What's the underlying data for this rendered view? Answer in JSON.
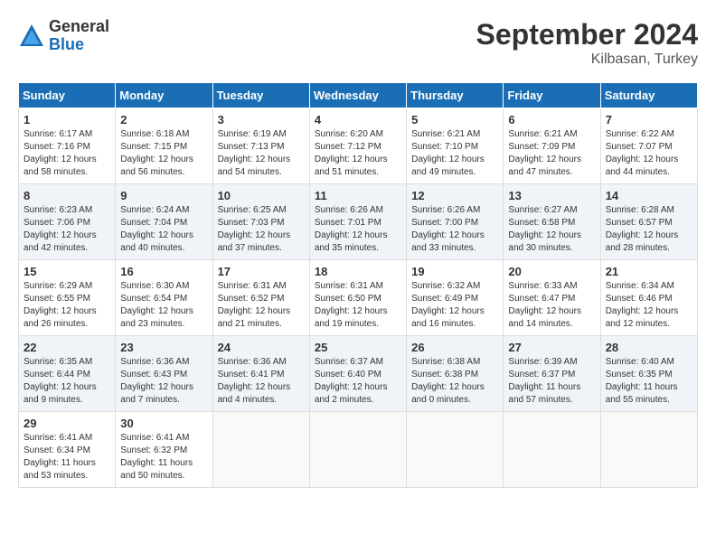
{
  "header": {
    "logo_general": "General",
    "logo_blue": "Blue",
    "title": "September 2024",
    "location": "Kilbasan, Turkey"
  },
  "calendar": {
    "days_of_week": [
      "Sunday",
      "Monday",
      "Tuesday",
      "Wednesday",
      "Thursday",
      "Friday",
      "Saturday"
    ],
    "weeks": [
      [
        {
          "day": "1",
          "info": "Sunrise: 6:17 AM\nSunset: 7:16 PM\nDaylight: 12 hours\nand 58 minutes."
        },
        {
          "day": "2",
          "info": "Sunrise: 6:18 AM\nSunset: 7:15 PM\nDaylight: 12 hours\nand 56 minutes."
        },
        {
          "day": "3",
          "info": "Sunrise: 6:19 AM\nSunset: 7:13 PM\nDaylight: 12 hours\nand 54 minutes."
        },
        {
          "day": "4",
          "info": "Sunrise: 6:20 AM\nSunset: 7:12 PM\nDaylight: 12 hours\nand 51 minutes."
        },
        {
          "day": "5",
          "info": "Sunrise: 6:21 AM\nSunset: 7:10 PM\nDaylight: 12 hours\nand 49 minutes."
        },
        {
          "day": "6",
          "info": "Sunrise: 6:21 AM\nSunset: 7:09 PM\nDaylight: 12 hours\nand 47 minutes."
        },
        {
          "day": "7",
          "info": "Sunrise: 6:22 AM\nSunset: 7:07 PM\nDaylight: 12 hours\nand 44 minutes."
        }
      ],
      [
        {
          "day": "8",
          "info": "Sunrise: 6:23 AM\nSunset: 7:06 PM\nDaylight: 12 hours\nand 42 minutes."
        },
        {
          "day": "9",
          "info": "Sunrise: 6:24 AM\nSunset: 7:04 PM\nDaylight: 12 hours\nand 40 minutes."
        },
        {
          "day": "10",
          "info": "Sunrise: 6:25 AM\nSunset: 7:03 PM\nDaylight: 12 hours\nand 37 minutes."
        },
        {
          "day": "11",
          "info": "Sunrise: 6:26 AM\nSunset: 7:01 PM\nDaylight: 12 hours\nand 35 minutes."
        },
        {
          "day": "12",
          "info": "Sunrise: 6:26 AM\nSunset: 7:00 PM\nDaylight: 12 hours\nand 33 minutes."
        },
        {
          "day": "13",
          "info": "Sunrise: 6:27 AM\nSunset: 6:58 PM\nDaylight: 12 hours\nand 30 minutes."
        },
        {
          "day": "14",
          "info": "Sunrise: 6:28 AM\nSunset: 6:57 PM\nDaylight: 12 hours\nand 28 minutes."
        }
      ],
      [
        {
          "day": "15",
          "info": "Sunrise: 6:29 AM\nSunset: 6:55 PM\nDaylight: 12 hours\nand 26 minutes."
        },
        {
          "day": "16",
          "info": "Sunrise: 6:30 AM\nSunset: 6:54 PM\nDaylight: 12 hours\nand 23 minutes."
        },
        {
          "day": "17",
          "info": "Sunrise: 6:31 AM\nSunset: 6:52 PM\nDaylight: 12 hours\nand 21 minutes."
        },
        {
          "day": "18",
          "info": "Sunrise: 6:31 AM\nSunset: 6:50 PM\nDaylight: 12 hours\nand 19 minutes."
        },
        {
          "day": "19",
          "info": "Sunrise: 6:32 AM\nSunset: 6:49 PM\nDaylight: 12 hours\nand 16 minutes."
        },
        {
          "day": "20",
          "info": "Sunrise: 6:33 AM\nSunset: 6:47 PM\nDaylight: 12 hours\nand 14 minutes."
        },
        {
          "day": "21",
          "info": "Sunrise: 6:34 AM\nSunset: 6:46 PM\nDaylight: 12 hours\nand 12 minutes."
        }
      ],
      [
        {
          "day": "22",
          "info": "Sunrise: 6:35 AM\nSunset: 6:44 PM\nDaylight: 12 hours\nand 9 minutes."
        },
        {
          "day": "23",
          "info": "Sunrise: 6:36 AM\nSunset: 6:43 PM\nDaylight: 12 hours\nand 7 minutes."
        },
        {
          "day": "24",
          "info": "Sunrise: 6:36 AM\nSunset: 6:41 PM\nDaylight: 12 hours\nand 4 minutes."
        },
        {
          "day": "25",
          "info": "Sunrise: 6:37 AM\nSunset: 6:40 PM\nDaylight: 12 hours\nand 2 minutes."
        },
        {
          "day": "26",
          "info": "Sunrise: 6:38 AM\nSunset: 6:38 PM\nDaylight: 12 hours\nand 0 minutes."
        },
        {
          "day": "27",
          "info": "Sunrise: 6:39 AM\nSunset: 6:37 PM\nDaylight: 11 hours\nand 57 minutes."
        },
        {
          "day": "28",
          "info": "Sunrise: 6:40 AM\nSunset: 6:35 PM\nDaylight: 11 hours\nand 55 minutes."
        }
      ],
      [
        {
          "day": "29",
          "info": "Sunrise: 6:41 AM\nSunset: 6:34 PM\nDaylight: 11 hours\nand 53 minutes."
        },
        {
          "day": "30",
          "info": "Sunrise: 6:41 AM\nSunset: 6:32 PM\nDaylight: 11 hours\nand 50 minutes."
        },
        {
          "day": "",
          "info": ""
        },
        {
          "day": "",
          "info": ""
        },
        {
          "day": "",
          "info": ""
        },
        {
          "day": "",
          "info": ""
        },
        {
          "day": "",
          "info": ""
        }
      ]
    ]
  }
}
